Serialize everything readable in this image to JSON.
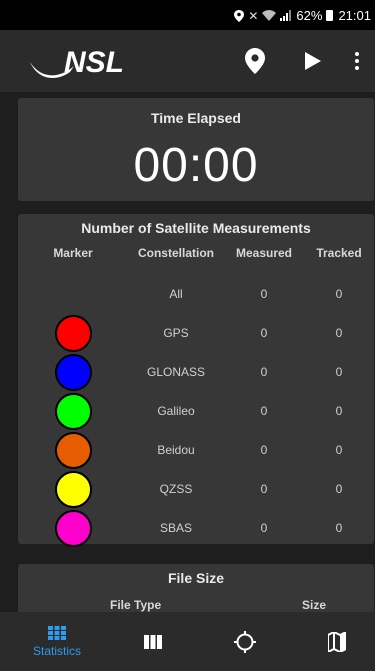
{
  "status_bar": {
    "battery": "62%",
    "time": "21:01"
  },
  "app_bar": {
    "logo_text": "NSL"
  },
  "time_card": {
    "title": "Time Elapsed",
    "value": "00:00"
  },
  "satellite_card": {
    "title": "Number of Satellite Measurements",
    "headers": {
      "marker": "Marker",
      "constellation": "Constellation",
      "measured": "Measured",
      "tracked": "Tracked"
    },
    "rows": [
      {
        "name": "All",
        "measured": "0",
        "tracked": "0",
        "color": ""
      },
      {
        "name": "GPS",
        "measured": "0",
        "tracked": "0",
        "color": "#ff0000"
      },
      {
        "name": "GLONASS",
        "measured": "0",
        "tracked": "0",
        "color": "#0000ff"
      },
      {
        "name": "Galileo",
        "measured": "0",
        "tracked": "0",
        "color": "#00ff00"
      },
      {
        "name": "Beidou",
        "measured": "0",
        "tracked": "0",
        "color": "#e65c00"
      },
      {
        "name": "QZSS",
        "measured": "0",
        "tracked": "0",
        "color": "#ffff00"
      },
      {
        "name": "SBAS",
        "measured": "0",
        "tracked": "0",
        "color": "#ff00cc"
      }
    ]
  },
  "file_card": {
    "title": "File Size",
    "col_type": "File Type",
    "col_size": "Size"
  },
  "bottom_nav": {
    "items": [
      {
        "label": "Statistics",
        "icon": "grid-icon",
        "active": true
      },
      {
        "label": "",
        "icon": "columns-icon",
        "active": false
      },
      {
        "label": "",
        "icon": "crosshair-icon",
        "active": false
      },
      {
        "label": "",
        "icon": "map-icon",
        "active": false
      }
    ],
    "active_color": "#2e9bf0"
  }
}
